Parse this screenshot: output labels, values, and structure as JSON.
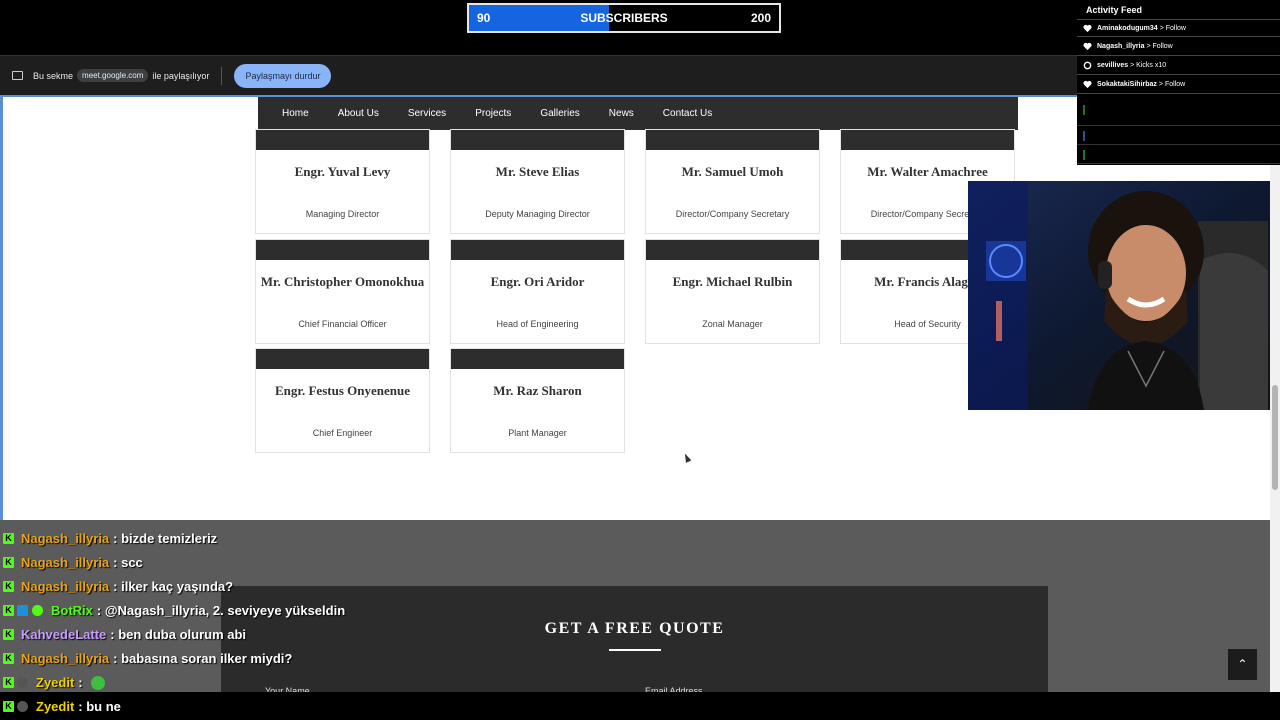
{
  "subscribers": {
    "current": "90",
    "label": "SUBSCRIBERS",
    "goal": "200",
    "fill_color": "#1565e0",
    "progress": 0.45
  },
  "share_bar": {
    "prefix": "Bu sekme",
    "domain": "meet.google.com",
    "suffix": "ile paylaşılıyor",
    "stop_button": "Paylaşmayı durdur"
  },
  "nav": {
    "items": [
      "Home",
      "About Us",
      "Services",
      "Projects",
      "Galleries",
      "News",
      "Contact Us"
    ]
  },
  "team": [
    {
      "name": "Engr. Yuval Levy",
      "role": "Managing Director"
    },
    {
      "name": "Mr. Steve Elias",
      "role": "Deputy Managing Director"
    },
    {
      "name": "Mr. Samuel Umoh",
      "role": "Director/Company Secretary"
    },
    {
      "name": "Mr. Walter Amachree",
      "role": "Director/Company Secretary"
    },
    {
      "name": "Mr. Christopher Omonokhua",
      "role": "Chief Financial Officer"
    },
    {
      "name": "Engr. Ori Aridor",
      "role": "Head of Engineering"
    },
    {
      "name": "Engr. Michael Rulbin",
      "role": "Zonal Manager"
    },
    {
      "name": "Mr. Francis Alagoa",
      "role": "Head of Security"
    },
    {
      "name": "Engr. Festus Onyenenue",
      "role": "Chief Engineer"
    },
    {
      "name": "Mr. Raz Sharon",
      "role": "Plant Manager"
    }
  ],
  "quote": {
    "title": "GET A FREE QUOTE",
    "name_label": "Your Name",
    "email_label": "Email Address",
    "back_to_top": "⌃"
  },
  "chat": [
    {
      "user": "Nagash_illyria",
      "color": "#e8a317",
      "text": ": bizde temizleriz"
    },
    {
      "user": "Nagash_illyria",
      "color": "#e8a317",
      "text": ": scc"
    },
    {
      "user": "Nagash_illyria",
      "color": "#e8a317",
      "text": ": ilker kaç yaşında?"
    },
    {
      "user": "BotRix",
      "color": "#53fc18",
      "text": ": @Nagash_illyria, 2. seviyeye yükseldin"
    },
    {
      "user": "KahvedeLatte",
      "color": "#c99cff",
      "text": ": ben duba olurum abi"
    },
    {
      "user": "Nagash_illyria",
      "color": "#e8a317",
      "text": ": babasına soran ilker miydi?"
    },
    {
      "user": "Zyedit",
      "color": "#f0d000",
      "text": ":"
    },
    {
      "user": "Zyedit",
      "color": "#f0d000",
      "text": ": bu ne"
    }
  ],
  "activity_feed": {
    "title": "Activity Feed",
    "items": [
      {
        "user": "Aminakodugum34",
        "event": "> Follow"
      },
      {
        "user": "Nagash_illyria",
        "event": "> Follow"
      },
      {
        "user": "sevillives",
        "event": "> Kicks x10"
      },
      {
        "user": "SokaktakiSihirbaz",
        "event": "> Follow"
      }
    ]
  }
}
